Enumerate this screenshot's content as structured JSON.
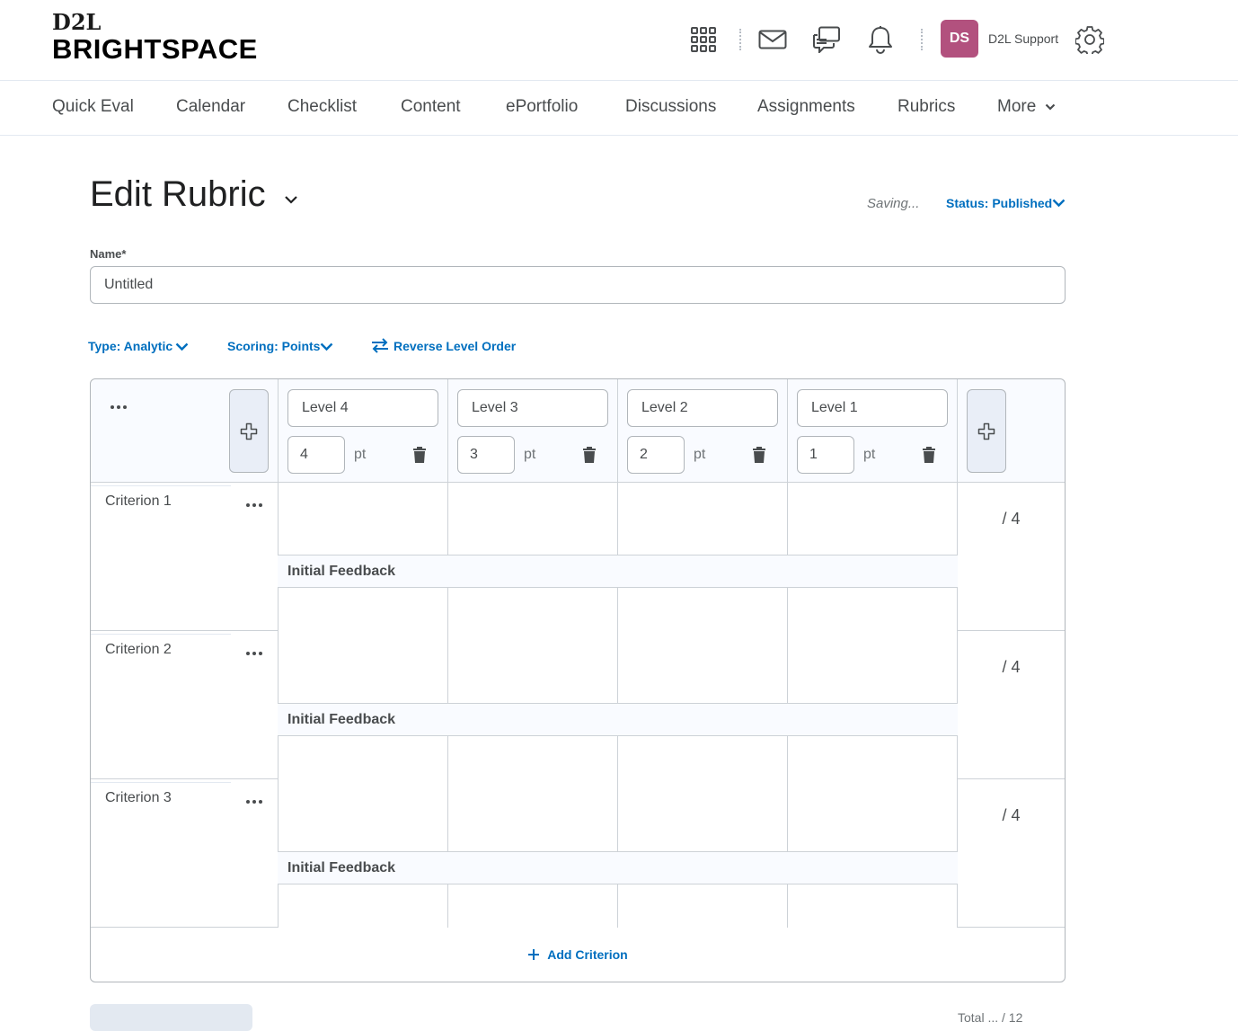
{
  "brand": {
    "line1": "D2L",
    "line2": "BRIGHTSPACE",
    "accent_color": "#c0622f"
  },
  "header": {
    "icons": [
      "grid-icon",
      "mail-icon",
      "chat-icon",
      "bell-icon",
      "gear-icon"
    ],
    "avatar_initials": "DS",
    "avatar_color": "#b2517e",
    "username": "D2L Support"
  },
  "nav": {
    "items": [
      "Quick Eval",
      "Calendar",
      "Checklist",
      "Content",
      "ePortfolio",
      "Discussions",
      "Assignments",
      "Rubrics"
    ],
    "more_label": "More"
  },
  "page": {
    "title": "Edit Rubric",
    "saving_text": "Saving...",
    "status_label": "Status: Published",
    "name_label": "Name*",
    "name_value": "Untitled",
    "type_label": "Type: Analytic",
    "scoring_label": "Scoring: Points",
    "reverse_label": "Reverse Level Order",
    "link_color": "#006fbf"
  },
  "rubric": {
    "levels": [
      {
        "name": "Level 4",
        "points": "4",
        "unit": "pt"
      },
      {
        "name": "Level 3",
        "points": "3",
        "unit": "pt"
      },
      {
        "name": "Level 2",
        "points": "2",
        "unit": "pt"
      },
      {
        "name": "Level 1",
        "points": "1",
        "unit": "pt"
      }
    ],
    "criteria": [
      {
        "name": "Criterion 1",
        "feedback_label": "Initial Feedback",
        "score": "/ 4"
      },
      {
        "name": "Criterion 2",
        "feedback_label": "Initial Feedback",
        "score": "/ 4"
      },
      {
        "name": "Criterion 3",
        "feedback_label": "Initial Feedback",
        "score": "/ 4"
      }
    ],
    "add_criterion_label": "Add Criterion"
  },
  "footer": {
    "partial_text": "Total  ...  / 12"
  }
}
